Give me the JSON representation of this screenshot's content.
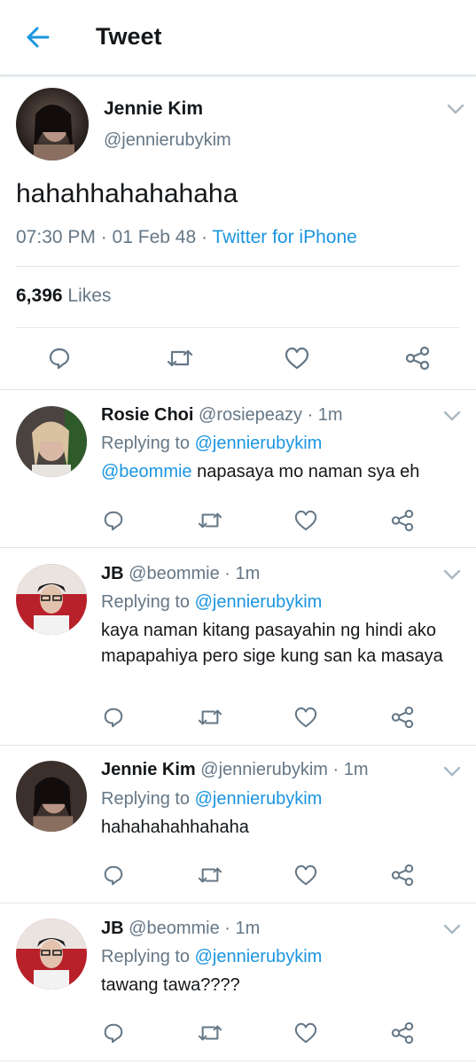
{
  "header": {
    "title": "Tweet"
  },
  "main_tweet": {
    "name": "Jennie Kim",
    "handle": "@jennierubykim",
    "text": "hahahhahahahaha",
    "time": "07:30 PM · 01 Feb 48 · ",
    "source": "Twitter for iPhone",
    "likes_count": "6,396",
    "likes_label": "Likes"
  },
  "replies": [
    {
      "name": "Rosie Choi",
      "handle": "@rosiepeazy · 1m",
      "replying_label": "Replying to ",
      "replying_to": "@jennierubykim",
      "mention": "@beommie",
      "text": " napasaya mo naman sya eh"
    },
    {
      "name": "JB",
      "handle": "@beommie · 1m",
      "replying_label": "Replying to ",
      "replying_to": "@jennierubykim",
      "text": "kaya naman kitang pasayahin ng hindi ako mapapahiya pero sige kung san ka masaya"
    },
    {
      "name": "Jennie Kim",
      "handle": "@jennierubykim · 1m",
      "replying_label": "Replying to ",
      "replying_to": "@jennierubykim",
      "text": "hahahahahhahaha"
    },
    {
      "name": "JB",
      "handle": "@beommie · 1m",
      "replying_label": "Replying to ",
      "replying_to": "@jennierubykim",
      "text": "tawang tawa????"
    }
  ],
  "icons": [
    "back-arrow-icon",
    "chevron-down-icon",
    "reply-icon",
    "retweet-icon",
    "like-icon",
    "share-icon"
  ],
  "colors": {
    "accent": "#1b95e0",
    "secondary_text": "#657786",
    "divider": "#e1e8ed"
  }
}
